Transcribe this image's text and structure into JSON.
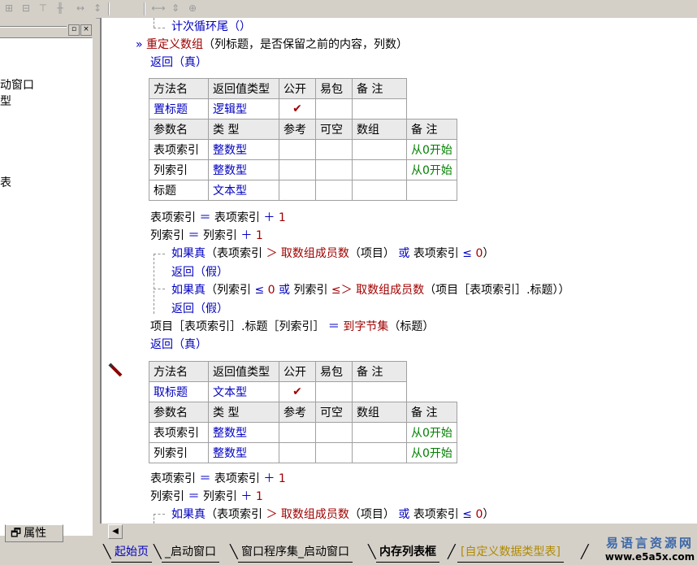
{
  "toolbar": {
    "icons": [
      "align-left-icon",
      "align-center-icon",
      "align-top-icon",
      "align-middle-icon",
      "width-equal-icon",
      "height-equal-icon",
      "expand-h-icon",
      "expand-v-icon",
      "center-icon"
    ]
  },
  "left_panel": {
    "tree_items": [
      "动窗口",
      "型",
      "表"
    ],
    "properties_tab": "属性",
    "properties_icon": "properties-icon"
  },
  "code": {
    "line_loop_tail": "计次循环尾（）",
    "method1_sig_name": "重定义数组",
    "method1_sig_args": "（列标题，是否保留之前的内容，列数）",
    "return_true_1": "返回（真）",
    "table_headers": {
      "method_name": "方法名",
      "return_type": "返回值类型",
      "public": "公开",
      "easy_pkg": "易包",
      "remark": "备 注",
      "param_name": "参数名",
      "type": "类 型",
      "reference": "参考",
      "nullable": "可空",
      "array": "数组"
    },
    "method2": {
      "name": "置标题",
      "return_type": "逻辑型",
      "public_mark": "✔",
      "params": [
        {
          "name": "表项索引",
          "type": "整数型",
          "remark": "从0开始"
        },
        {
          "name": "列索引",
          "type": "整数型",
          "remark": "从0开始"
        },
        {
          "name": "标题",
          "type": "文本型",
          "remark": ""
        }
      ]
    },
    "l_a1": "表项索引",
    "l_a2": "＝",
    "l_a3": "表项索引",
    "l_a4": "＋",
    "l_a5": "1",
    "l_b1": "列索引",
    "l_b2": "＝",
    "l_b3": "列索引",
    "l_b4": "＋",
    "l_b5": "1",
    "if1_kw": "如果真",
    "if1_a": "（表项索引",
    "if1_op": "＞",
    "if1_fn": "取数组成员数",
    "if1_b": "（项目）",
    "if1_or": "或",
    "if1_c": "表项索引",
    "if1_op2": "≤",
    "if1_num": "0",
    "if1_end": "）",
    "ret_false_1": "返回（假）",
    "if2_kw": "如果真",
    "if2_a": "（列索引",
    "if2_op": "≤",
    "if2_num": "0",
    "if2_or": "或",
    "if2_b": "列索引",
    "if2_op2": "＞",
    "if2_fn": "取数组成员数",
    "if2_c": "（项目［表项索引］.标题））",
    "ret_false_2": "返回（假）",
    "assign_lhs": "项目［表项索引］.标题［列索引］",
    "assign_eq": "＝",
    "assign_fn": "到字节集",
    "assign_arg": "（标题）",
    "return_true_2": "返回（真）",
    "method3": {
      "name": "取标题",
      "return_type": "文本型",
      "public_mark": "✔",
      "params": [
        {
          "name": "表项索引",
          "type": "整数型",
          "remark": "从0开始"
        },
        {
          "name": "列索引",
          "type": "整数型",
          "remark": "从0开始"
        }
      ]
    },
    "if3_kw": "如果真",
    "if3_a": "（表项索引",
    "if3_op": "＞",
    "if3_fn": "取数组成员数",
    "if3_b": "（项目）",
    "if3_or": "或",
    "if3_c": "表项索引",
    "if3_op2": "≤",
    "if3_num": "0",
    "if3_end": "）"
  },
  "tabs": [
    "起始页",
    "_启动窗口",
    "窗口程序集_启动窗口",
    "内存列表框",
    "[自定义数据类型表]"
  ],
  "brand": {
    "line1": "易语言资源网",
    "line2": "www.e5a5x.com"
  }
}
